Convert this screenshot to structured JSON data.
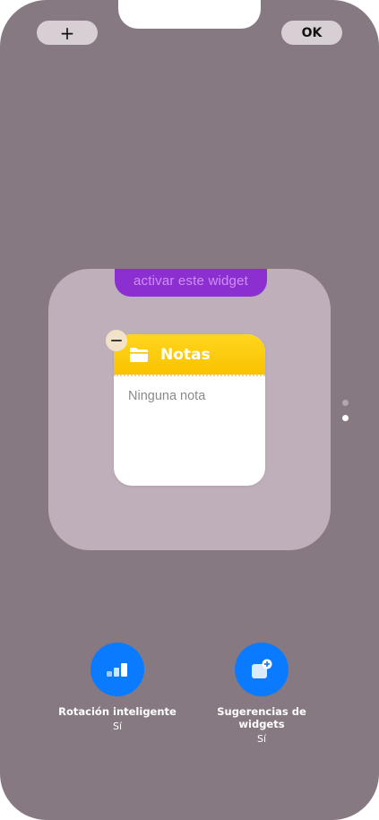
{
  "toolbar": {
    "add_label": "+",
    "ok_label": "OK"
  },
  "stack": {
    "peek_widget_text": "activar este widget",
    "notes_widget": {
      "title": "Notas",
      "empty_text": "Ninguna nota",
      "icon": "folder-icon",
      "accent": "#f9c200"
    }
  },
  "pager": {
    "pages": 2,
    "current": 2
  },
  "actions": [
    {
      "label": "Rotación inteligente",
      "value": "Sí",
      "icon": "smart-rotate-icon"
    },
    {
      "label": "Sugerencias de widgets",
      "value": "Sí",
      "icon": "widget-suggestions-icon"
    }
  ],
  "colors": {
    "background": "#877982",
    "stack": "#bfafba",
    "action_blue": "#0a7bff",
    "peek_widget": "#8c2fd0"
  }
}
